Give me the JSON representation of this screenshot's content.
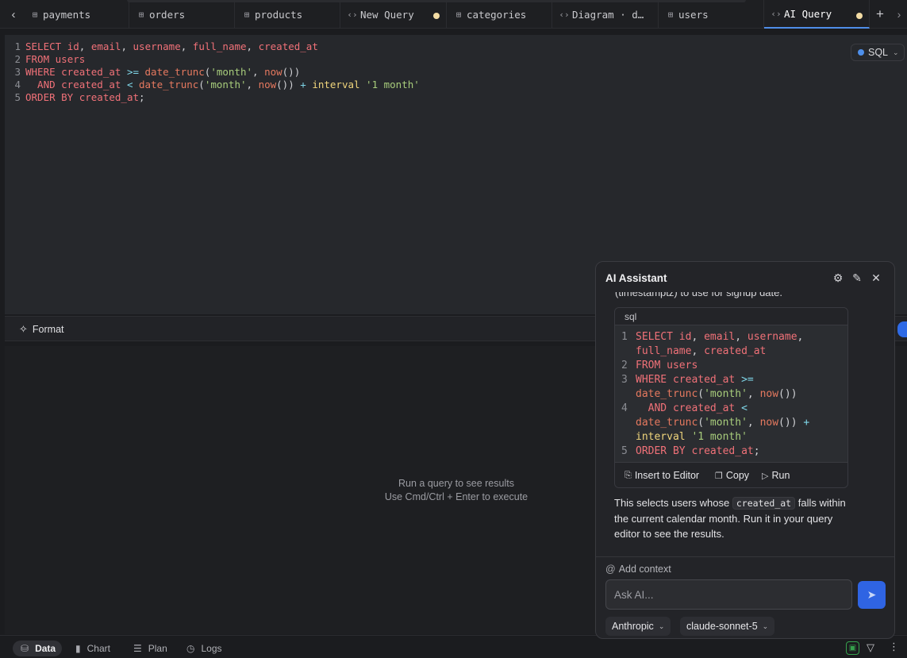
{
  "tabs": [
    {
      "label": "payments",
      "icon": "table-icon",
      "dirty": false,
      "active": false
    },
    {
      "label": "orders",
      "icon": "table-icon",
      "dirty": false,
      "active": false
    },
    {
      "label": "products",
      "icon": "table-icon",
      "dirty": false,
      "active": false
    },
    {
      "label": "New Query",
      "icon": "code-icon",
      "dirty": true,
      "active": false
    },
    {
      "label": "categories",
      "icon": "table-icon",
      "dirty": false,
      "active": false
    },
    {
      "label": "Diagram · d…",
      "icon": "code-icon",
      "dirty": false,
      "active": false
    },
    {
      "label": "users",
      "icon": "table-icon",
      "dirty": false,
      "active": false
    },
    {
      "label": "AI Query",
      "icon": "code-icon",
      "dirty": true,
      "active": true
    }
  ],
  "editor": {
    "language": "SQL",
    "line_numbers": [
      "1",
      "2",
      "3",
      "4",
      "5"
    ],
    "lines": [
      "SELECT id, email, username, full_name, created_at",
      "FROM users",
      "WHERE created_at >= date_trunc('month', now())",
      "  AND created_at < date_trunc('month', now()) + interval '1 month'",
      "ORDER BY created_at;"
    ]
  },
  "toolbar": {
    "format_label": "Format"
  },
  "results": {
    "empty_title": "Run a query to see results",
    "empty_hint": "Use Cmd/Ctrl + Enter to execute"
  },
  "bottom_tabs": [
    {
      "label": "Data",
      "icon": "database-icon",
      "active": true
    },
    {
      "label": "Chart",
      "icon": "bar-chart-icon",
      "active": false
    },
    {
      "label": "Plan",
      "icon": "list-tree-icon",
      "active": false
    },
    {
      "label": "Logs",
      "icon": "clock-icon",
      "active": false
    }
  ],
  "ai": {
    "title": "AI Assistant",
    "cut_text": "(timestamptz) to use for signup date.",
    "code_lang": "sql",
    "code_lines": [
      {
        "num": "1",
        "rows": [
          "SELECT id, email, username,",
          "full_name, created_at"
        ]
      },
      {
        "num": "2",
        "rows": [
          "FROM users"
        ]
      },
      {
        "num": "3",
        "rows": [
          "WHERE created_at >=",
          "date_trunc('month', now())"
        ]
      },
      {
        "num": "4",
        "rows": [
          "  AND created_at <",
          "date_trunc('month', now()) +",
          "interval '1 month'"
        ]
      },
      {
        "num": "5",
        "rows": [
          "ORDER BY created_at;"
        ]
      }
    ],
    "insert_label": "Insert to Editor",
    "copy_label": "Copy",
    "run_label": "Run",
    "explain_before": "This selects users whose",
    "explain_code": "created_at",
    "explain_after": "falls within the current calendar month. Run it in your query editor to see the results.",
    "add_context": "Add context",
    "ask_placeholder": "Ask AI...",
    "provider": "Anthropic",
    "model": "claude-sonnet-5"
  }
}
